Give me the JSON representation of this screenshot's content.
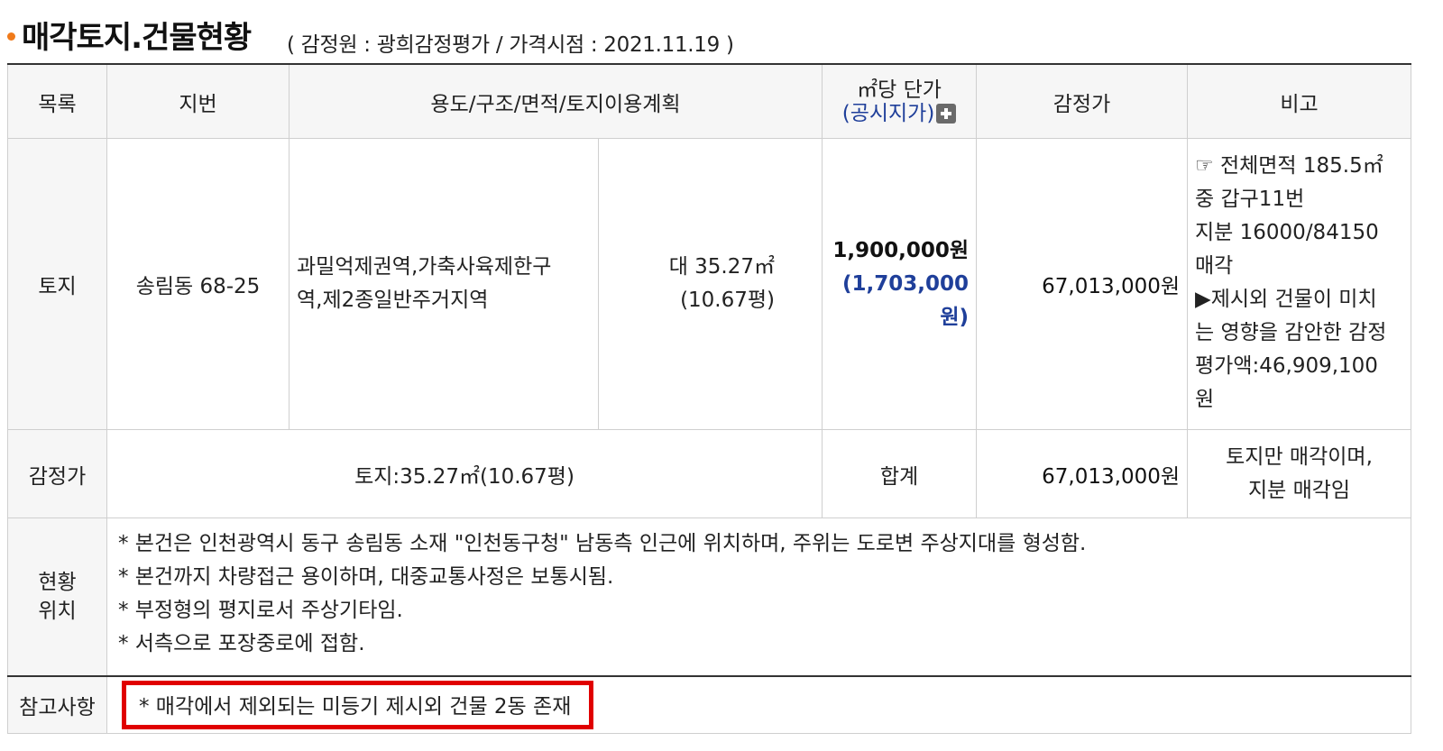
{
  "header": {
    "title": "매각토지.건물현황",
    "subtitle": "( 감정원 : 광희감정평가 / 가격시점 : 2021.11.19 )"
  },
  "table": {
    "columns": {
      "col1": "목록",
      "col2": "지번",
      "col3": "용도/구조/면적/토지이용계획",
      "col4_line1": "㎡당 단가",
      "col4_link": "(공시지가)",
      "col5": "감정가",
      "col6": "비고"
    },
    "land_row": {
      "type": "토지",
      "lot": "송림동 68-25",
      "usage_line1": "과밀억제권역,가축사육제한구",
      "usage_line2": "역,제2종일반주거지역",
      "area_line1": "대 35.27㎡",
      "area_line2": "(10.67평)",
      "unit_price": "1,900,000원",
      "official_price": "(1,703,000원)",
      "appraisal": "67,013,000원",
      "remarks": [
        "☞ 전체면적 185.5㎡",
        "중 갑구11번",
        "지분 16000/84150",
        "매각",
        "▶제시외 건물이 미치",
        "는 영향을 감안한 감정",
        "평가액:46,909,100",
        "원"
      ]
    },
    "appraisal_row": {
      "label": "감정가",
      "summary": "토지:35.27㎡(10.67평)",
      "total_label": "합계",
      "total": "67,013,000원",
      "note_line1": "토지만 매각이며,",
      "note_line2": "지분 매각임"
    },
    "location_row": {
      "label_line1": "현황",
      "label_line2": "위치",
      "items": [
        "* 본건은 인천광역시 동구 송림동 소재 \"인천동구청\" 남동측 인근에 위치하며, 주위는 도로변 주상지대를 형성함.",
        "* 본건까지 차량접근 용이하며, 대중교통사정은 보통시됨.",
        "* 부정형의 평지로서 주상기타임.",
        "* 서측으로 포장중로에 접함."
      ]
    },
    "reference_row": {
      "label": "참고사항",
      "text": "* 매각에서 제외되는 미등기 제시외 건물 2동 존재"
    }
  },
  "colors": {
    "bullet": "#f07a1a",
    "link_blue": "#1f3f9a",
    "highlight_red": "#e00000",
    "header_bg": "#f6f6f6",
    "border": "#cfcfcf"
  }
}
